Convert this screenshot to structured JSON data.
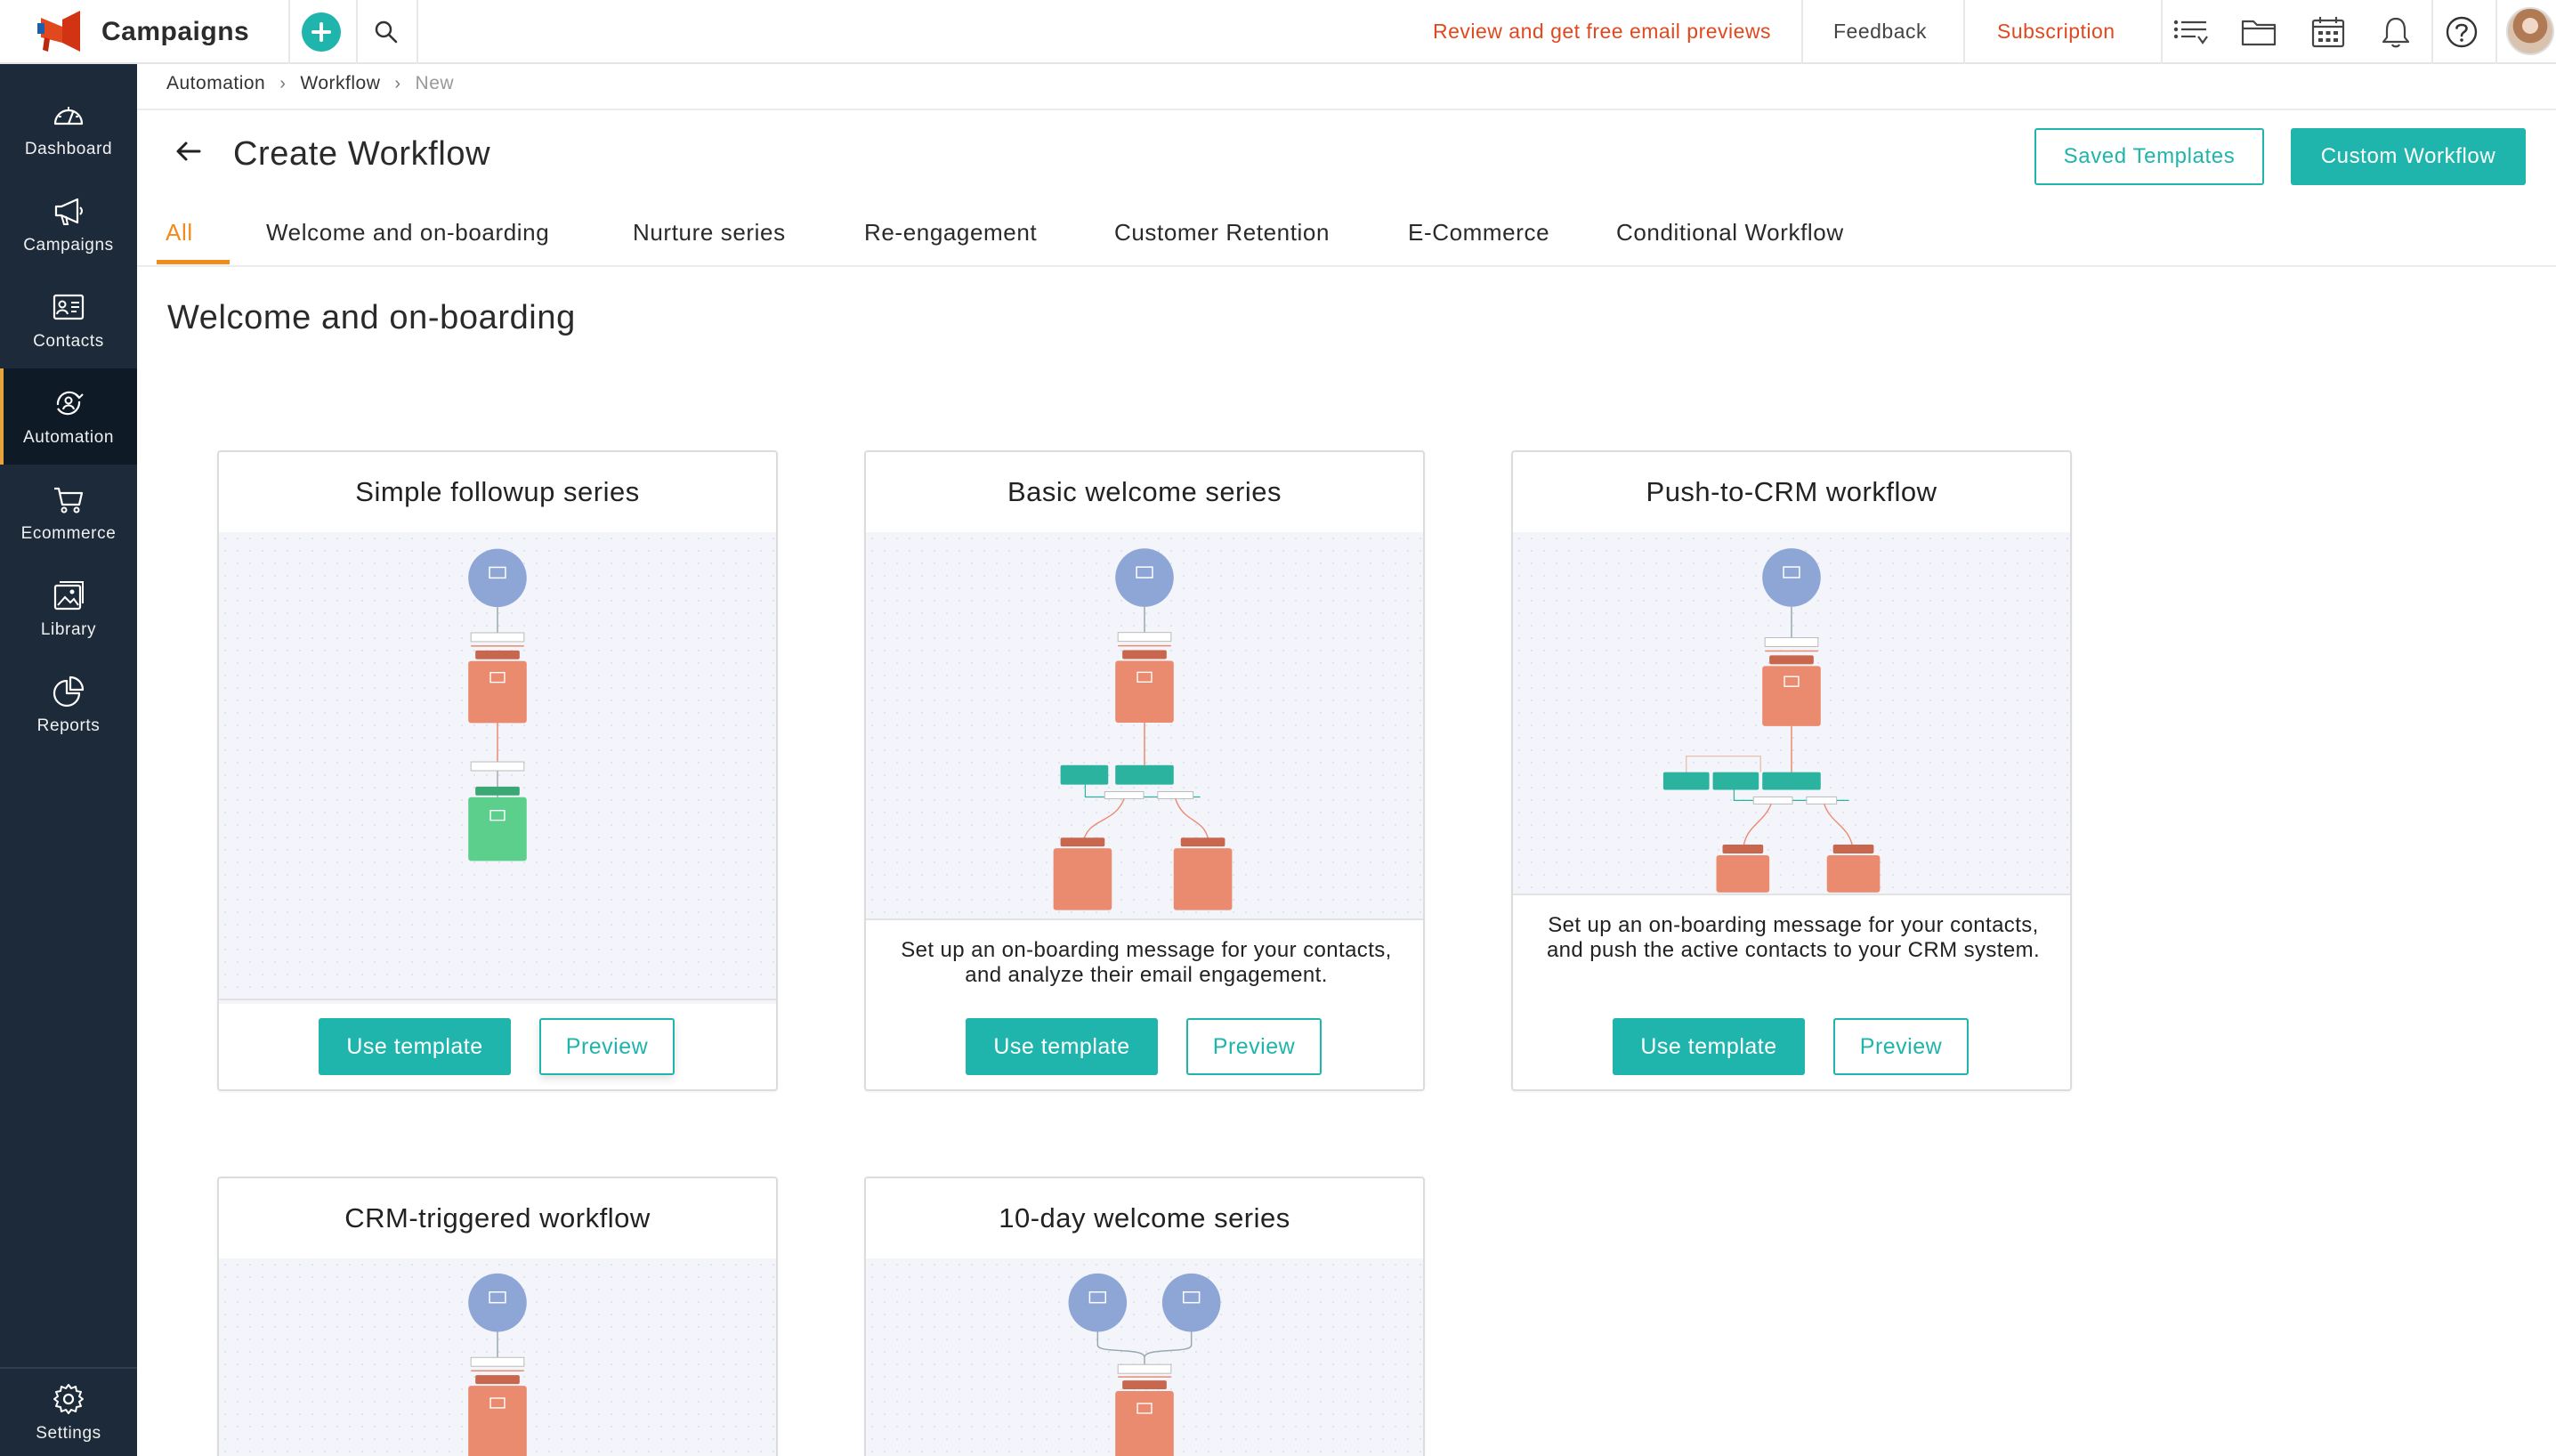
{
  "app": {
    "name": "Campaigns",
    "brand_color": "#e2481e",
    "accent_color": "#1fb5ac"
  },
  "topbar": {
    "add_icon": "plus-circle-icon",
    "search_icon": "search-icon",
    "promo_text": "Review and get free email previews",
    "feedback_label": "Feedback",
    "subscription_label": "Subscription",
    "icons": [
      "list-filter-icon",
      "folder-icon",
      "calendar-icon",
      "bell-icon",
      "help-icon",
      "avatar"
    ]
  },
  "sidebar": {
    "items": [
      {
        "label": "Dashboard",
        "icon": "speedometer-icon"
      },
      {
        "label": "Campaigns",
        "icon": "megaphone-icon"
      },
      {
        "label": "Contacts",
        "icon": "contact-card-icon"
      },
      {
        "label": "Automation",
        "icon": "automation-icon",
        "active": true
      },
      {
        "label": "Ecommerce",
        "icon": "cart-icon"
      },
      {
        "label": "Library",
        "icon": "image-gallery-icon"
      },
      {
        "label": "Reports",
        "icon": "pie-chart-icon"
      }
    ],
    "settings": {
      "label": "Settings",
      "icon": "gear-icon"
    }
  },
  "breadcrumb": [
    "Automation",
    "Workflow",
    "New"
  ],
  "header": {
    "title": "Create Workflow",
    "saved_templates_label": "Saved Templates",
    "custom_workflow_label": "Custom Workflow"
  },
  "tabs": [
    {
      "label": "All",
      "active": true
    },
    {
      "label": "Welcome and on-boarding"
    },
    {
      "label": "Nurture series"
    },
    {
      "label": "Re-engagement"
    },
    {
      "label": "Customer Retention"
    },
    {
      "label": "E-Commerce"
    },
    {
      "label": "Conditional Workflow"
    }
  ],
  "section": {
    "title": "Welcome and on-boarding"
  },
  "cards": [
    {
      "title": "Simple followup series",
      "description": "",
      "use_label": "Use template",
      "preview_label": "Preview"
    },
    {
      "title": "Basic welcome series",
      "description": "Set up an on-boarding message for your contacts, and analyze their email engagement.",
      "use_label": "Use template",
      "preview_label": "Preview"
    },
    {
      "title": "Push-to-CRM workflow",
      "description": "Set up an on-boarding message for your contacts, and push the active contacts to your CRM system.",
      "use_label": "Use template",
      "preview_label": "Preview"
    },
    {
      "title": "CRM-triggered workflow"
    },
    {
      "title": "10-day welcome series"
    }
  ],
  "colors": {
    "node_trigger": "#8ea6d6",
    "node_email": "#ea8a6f",
    "node_condition": "#2bb3a0",
    "node_end": "#5ccf8c",
    "tab_active": "#f08b1c",
    "sidebar_bg": "#1d2a3a"
  }
}
